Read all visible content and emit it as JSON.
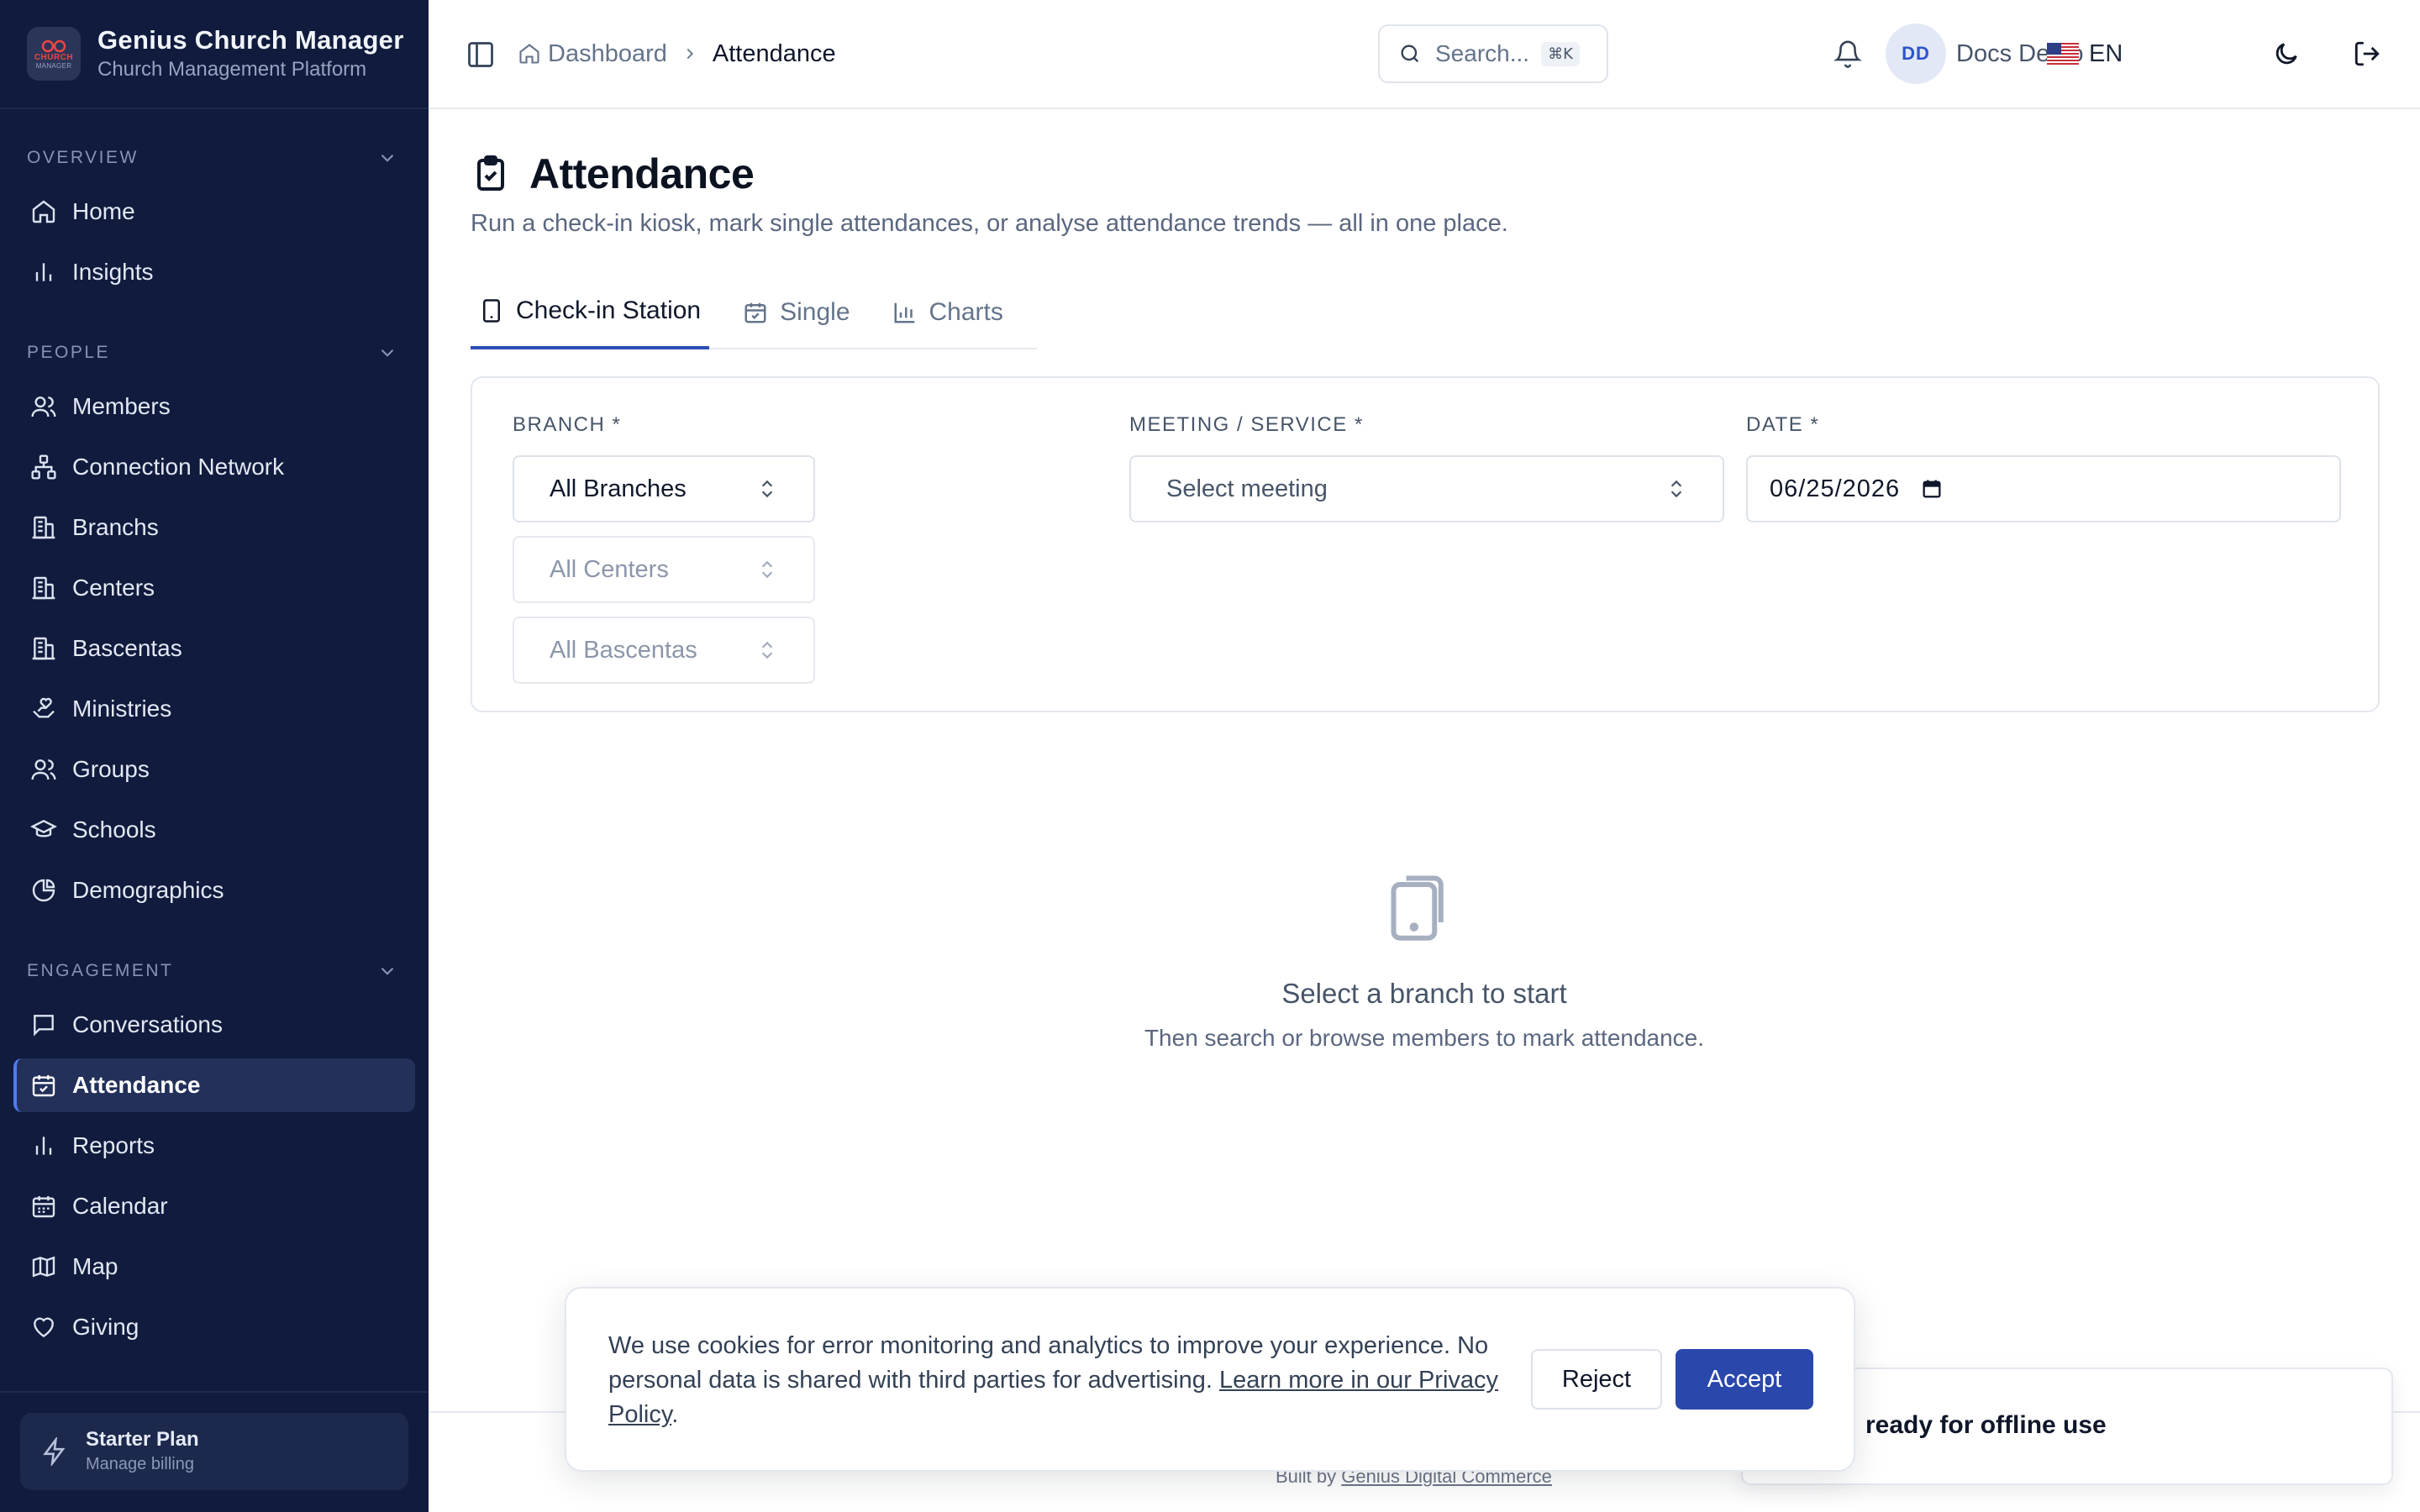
{
  "app": {
    "name": "Genius Church Manager",
    "subtitle": "Church Management Platform",
    "logo_text_top": "CHURCH",
    "logo_text_bottom": "MANAGER"
  },
  "sidebar": {
    "sections": [
      {
        "title": "OVERVIEW",
        "items": [
          {
            "label": "Home",
            "icon": "home-icon"
          },
          {
            "label": "Insights",
            "icon": "bar-chart-icon"
          }
        ]
      },
      {
        "title": "PEOPLE",
        "items": [
          {
            "label": "Members",
            "icon": "users-icon"
          },
          {
            "label": "Connection Network",
            "icon": "network-icon"
          },
          {
            "label": "Branchs",
            "icon": "building-icon"
          },
          {
            "label": "Centers",
            "icon": "building-icon"
          },
          {
            "label": "Bascentas",
            "icon": "building-icon"
          },
          {
            "label": "Ministries",
            "icon": "hand-heart-icon"
          },
          {
            "label": "Groups",
            "icon": "users-icon"
          },
          {
            "label": "Schools",
            "icon": "graduation-cap-icon"
          },
          {
            "label": "Demographics",
            "icon": "pie-chart-icon"
          }
        ]
      },
      {
        "title": "ENGAGEMENT",
        "items": [
          {
            "label": "Conversations",
            "icon": "message-icon"
          },
          {
            "label": "Attendance",
            "icon": "calendar-check-icon",
            "active": true
          },
          {
            "label": "Reports",
            "icon": "bar-chart-icon"
          },
          {
            "label": "Calendar",
            "icon": "calendar-icon"
          },
          {
            "label": "Map",
            "icon": "map-icon"
          },
          {
            "label": "Giving",
            "icon": "heart-icon"
          }
        ]
      }
    ],
    "plan": {
      "name": "Starter Plan",
      "sub": "Manage billing"
    }
  },
  "topbar": {
    "breadcrumb": {
      "parent": "Dashboard",
      "current": "Attendance"
    },
    "search": {
      "placeholder": "Search...",
      "shortcut": "⌘K"
    },
    "user": {
      "initials": "DD",
      "name": "Docs Demo"
    },
    "language": {
      "code": "EN",
      "flag": "us-flag"
    }
  },
  "page": {
    "title": "Attendance",
    "description": "Run a check-in kiosk, mark single attendances, or analyse attendance trends — all in one place.",
    "tabs": [
      {
        "label": "Check-in Station",
        "icon": "tablet-icon",
        "active": true
      },
      {
        "label": "Single",
        "icon": "calendar-check-icon"
      },
      {
        "label": "Charts",
        "icon": "bar-chart-icon"
      }
    ]
  },
  "filters": {
    "branch_label": "BRANCH *",
    "branch_value": "All Branches",
    "center_value": "All Centers",
    "bascenta_value": "All Bascentas",
    "meeting_label": "MEETING / SERVICE *",
    "meeting_placeholder": "Select meeting",
    "date_label": "DATE *",
    "date_value": "06/25/2026"
  },
  "empty_state": {
    "title": "Select a branch to start",
    "subtitle": "Then search or browse members to mark attendance."
  },
  "footer": {
    "built_by_prefix": "Built by",
    "built_by_link": "Genius Digital Commerce"
  },
  "toast": {
    "text": "ready for offline use"
  },
  "cookie_banner": {
    "text": "We use cookies for error monitoring and analytics to improve your experience. No personal data is shared with third parties for advertising.",
    "link": "Learn more in our Privacy Policy",
    "suffix": ".",
    "reject_label": "Reject",
    "accept_label": "Accept"
  },
  "colors": {
    "sidebar_bg": "#101b3d",
    "accent": "#2a48ab",
    "active_nav": "#22305a"
  }
}
